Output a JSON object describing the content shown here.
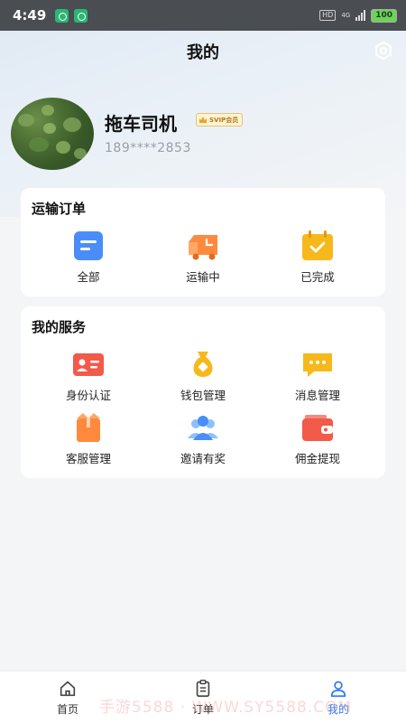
{
  "status_bar": {
    "time": "4:49",
    "hd": "HD",
    "network": "4G",
    "battery": "100"
  },
  "header": {
    "title": "我的"
  },
  "profile": {
    "name": "拖车司机",
    "vip": "SVIP会员",
    "phone": "189****2853"
  },
  "orders": {
    "title": "运输订单",
    "items": [
      {
        "label": "全部",
        "icon": "list-icon"
      },
      {
        "label": "运输中",
        "icon": "truck-icon"
      },
      {
        "label": "已完成",
        "icon": "calendar-check-icon"
      }
    ]
  },
  "services": {
    "title": "我的服务",
    "items": [
      {
        "label": "身份认证",
        "icon": "id-card-icon"
      },
      {
        "label": "钱包管理",
        "icon": "money-bag-icon"
      },
      {
        "label": "消息管理",
        "icon": "message-icon"
      },
      {
        "label": "客服管理",
        "icon": "customer-service-icon"
      },
      {
        "label": "邀请有奖",
        "icon": "invite-users-icon"
      },
      {
        "label": "佣金提现",
        "icon": "wallet-icon"
      }
    ]
  },
  "bottom_nav": {
    "items": [
      {
        "label": "首页",
        "icon": "home-icon"
      },
      {
        "label": "订单",
        "icon": "orders-icon"
      },
      {
        "label": "我的",
        "icon": "profile-icon",
        "active": true
      }
    ]
  },
  "watermark": "手游5588 · WWW.SY5588.COM",
  "colors": {
    "accent": "#2f7bf5",
    "orange": "#ff8a3d",
    "yellow": "#f7b81b",
    "red": "#f25a4a"
  }
}
